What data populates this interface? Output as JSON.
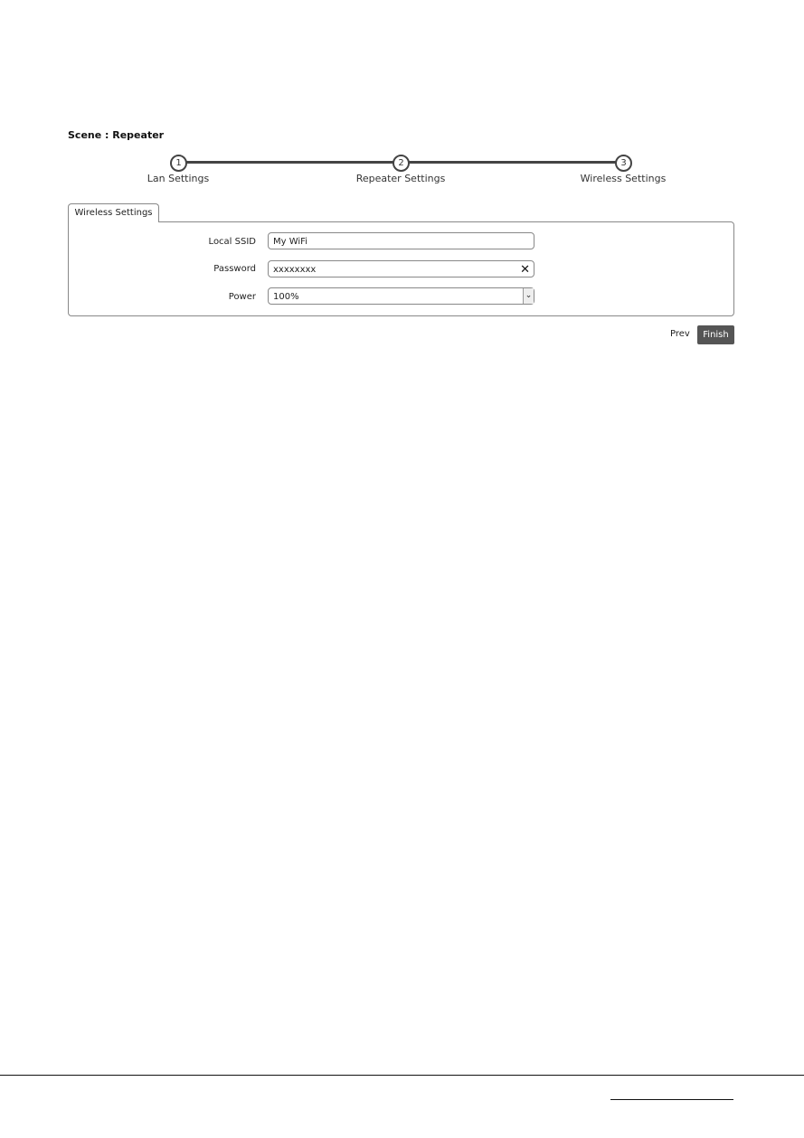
{
  "scene": {
    "title": "Scene : Repeater"
  },
  "steps": [
    {
      "number": "1",
      "label": "Lan Settings"
    },
    {
      "number": "2",
      "label": "Repeater Settings"
    },
    {
      "number": "3",
      "label": "Wireless Settings"
    }
  ],
  "tab": {
    "label": "Wireless Settings"
  },
  "form": {
    "local_ssid": {
      "label": "Local SSID",
      "value": "My WiFi"
    },
    "password": {
      "label": "Password",
      "value": "xxxxxxxx",
      "clear_icon": "close-icon"
    },
    "power": {
      "label": "Power",
      "value": "100%"
    }
  },
  "buttons": {
    "prev": "Prev",
    "finish": "Finish"
  },
  "colors": {
    "finish_bg": "#555555",
    "step_line": "#444444"
  }
}
